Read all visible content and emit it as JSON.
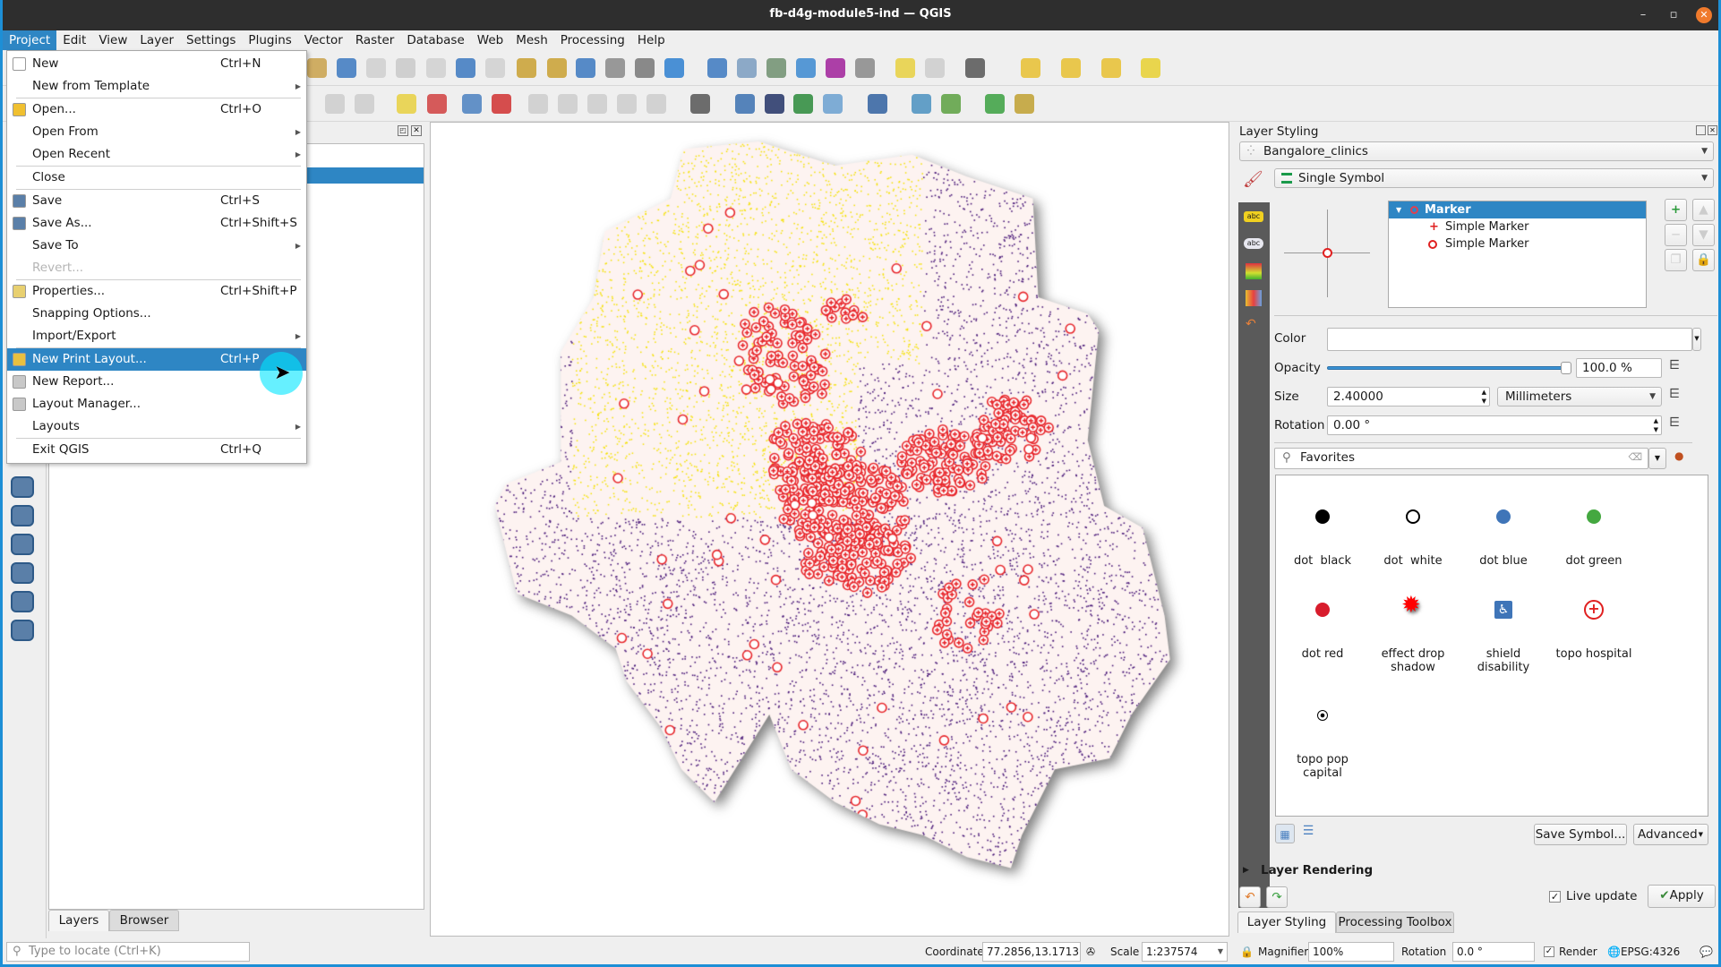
{
  "window": {
    "title": "fb-d4g-module5-ind — QGIS",
    "min": "–",
    "max": "▫",
    "close": "✕"
  },
  "menubar": [
    "Project",
    "Edit",
    "View",
    "Layer",
    "Settings",
    "Plugins",
    "Vector",
    "Raster",
    "Database",
    "Web",
    "Mesh",
    "Processing",
    "Help"
  ],
  "project_menu": [
    {
      "label": "New",
      "shortcut": "Ctrl+N",
      "icon": "new-file-icon",
      "color": "#ffffff"
    },
    {
      "label": "New from Template",
      "submenu": true
    },
    {
      "sep": true
    },
    {
      "label": "Open...",
      "shortcut": "Ctrl+O",
      "icon": "folder-icon",
      "color": "#f0c030"
    },
    {
      "label": "Open From",
      "submenu": true
    },
    {
      "label": "Open Recent",
      "submenu": true
    },
    {
      "sep": true
    },
    {
      "label": "Close"
    },
    {
      "sep": true
    },
    {
      "label": "Save",
      "shortcut": "Ctrl+S",
      "icon": "save-icon",
      "color": "#5a7fa8"
    },
    {
      "label": "Save As...",
      "shortcut": "Ctrl+Shift+S",
      "icon": "save-as-icon",
      "color": "#5a7fa8"
    },
    {
      "label": "Save To",
      "submenu": true
    },
    {
      "label": "Revert...",
      "disabled": true
    },
    {
      "sep": true
    },
    {
      "label": "Properties...",
      "shortcut": "Ctrl+Shift+P",
      "icon": "properties-icon",
      "color": "#e8d070"
    },
    {
      "label": "Snapping Options..."
    },
    {
      "label": "Import/Export",
      "submenu": true
    },
    {
      "sep": true
    },
    {
      "label": "New Print Layout...",
      "shortcut": "Ctrl+P",
      "icon": "print-layout-icon",
      "color": "#e8c040",
      "highlighted": true
    },
    {
      "label": "New Report...",
      "icon": "report-icon",
      "color": "#c8c8c8"
    },
    {
      "label": "Layout Manager...",
      "icon": "layout-manager-icon",
      "color": "#c8c8c8"
    },
    {
      "label": "Layouts",
      "submenu": true
    },
    {
      "sep": true
    },
    {
      "label": "Exit QGIS",
      "shortcut": "Ctrl+Q"
    }
  ],
  "toolbar1_icons": [
    [
      "zoom-in-icon",
      "#c9a14a"
    ],
    [
      "zoom-full-icon",
      "#3b78c0"
    ],
    [
      "zoom-selection-icon",
      "#cfcfcf"
    ],
    [
      "zoom-layer-icon",
      "#c9c9c9"
    ],
    [
      "zoom-native-icon",
      "#d0d0d0"
    ],
    [
      "zoom-last-icon",
      "#3b78c0"
    ],
    [
      "zoom-next-icon",
      "#d0d0d0"
    ],
    [
      "new-bookmark-icon",
      "#c9a030"
    ],
    [
      "show-bookmarks-icon",
      "#c9a030"
    ],
    [
      "spatial-bookmark-icon",
      "#3b78c0"
    ],
    [
      "temporal-icon",
      "#888888"
    ],
    [
      "clock-icon",
      "#777777"
    ],
    [
      "refresh-icon",
      "#2d7fd0"
    ],
    [
      "identify-icon",
      "#3b78c0"
    ],
    [
      "attribute-table-icon",
      "#7a9cc0"
    ],
    [
      "field-calculator-icon",
      "#6f8f6f"
    ],
    [
      "gear-icon",
      "#3b88d0"
    ],
    [
      "sigma-icon",
      "#a0209a"
    ],
    [
      "measure-icon",
      "#888888"
    ],
    [
      "annotation-icon",
      "#e8d040"
    ],
    [
      "map-tips-icon",
      "#cccccc"
    ],
    [
      "text-annotation-icon",
      "#555555"
    ],
    [
      "select-icon",
      "#e8c030"
    ],
    [
      "select-by-value-icon",
      "#e8c030"
    ],
    [
      "deselect-icon",
      "#e8c030"
    ],
    [
      "select-polygon-icon",
      "#e8d030"
    ]
  ],
  "toolbar2_icons": [
    [
      "undo-icon",
      "#cccccc"
    ],
    [
      "redo-icon",
      "#cccccc"
    ],
    [
      "label-icon",
      "#e8d040"
    ],
    [
      "diagram-icon",
      "#d04040"
    ],
    [
      "label-pin-icon",
      "#4a80c0"
    ],
    [
      "label-highlight-icon",
      "#d03030"
    ],
    [
      "label-move-icon",
      "#cccccc"
    ],
    [
      "label-show-icon",
      "#cccccc"
    ],
    [
      "label-rotate-icon",
      "#cccccc"
    ],
    [
      "label-change-icon",
      "#cccccc"
    ],
    [
      "label-edit-icon",
      "#cccccc"
    ],
    [
      "osm-search-icon",
      "#555555"
    ],
    [
      "python-icon",
      "#3a70b0"
    ],
    [
      "globe-icon",
      "#223366"
    ],
    [
      "info-icon",
      "#2a8a3a"
    ],
    [
      "map-swipe-icon",
      "#6aa0d0"
    ],
    [
      "help-icon",
      "#3060a0"
    ],
    [
      "georeferencer-icon",
      "#4a90c0"
    ],
    [
      "raster-calc-icon",
      "#5aa040"
    ],
    [
      "zoom-green-icon",
      "#3aa040"
    ],
    [
      "digitize-icon",
      "#c0a030"
    ]
  ],
  "left_toolbar_icons": [
    "add-vector-layer-icon",
    "add-postgis-layer-icon",
    "add-wms-layer-icon",
    "add-wfs-layer-icon",
    "add-virtual-layer-icon",
    "add-geopackage-icon"
  ],
  "layers_panel": {
    "tabs": [
      "Layers",
      "Browser"
    ],
    "search_placeholder": "Type to locate (Ctrl+K)"
  },
  "layer_styling": {
    "title": "Layer Styling",
    "layer": "Bangalore_clinics",
    "renderer": "Single Symbol",
    "tree": {
      "root": "Marker",
      "children": [
        "Simple Marker",
        "Simple Marker"
      ]
    },
    "color_label": "Color",
    "opacity_label": "Opacity",
    "opacity": 100.0,
    "opacity_text": "100.0 %",
    "size_label": "Size",
    "size": "2.40000",
    "size_unit": "Millimeters",
    "rotation_label": "Rotation",
    "rotation": "0.00 °",
    "library_filter": "Favorites",
    "symbols": [
      {
        "name": "dot  black",
        "icon": "black-dot-icon",
        "color": "#000000"
      },
      {
        "name": "dot  white",
        "icon": "white-dot-icon",
        "color": "#ffffff"
      },
      {
        "name": "dot blue",
        "icon": "blue-dot-icon",
        "color": "#3f75b8"
      },
      {
        "name": "dot green",
        "icon": "green-dot-icon",
        "color": "#44a840"
      },
      {
        "name": "dot red",
        "icon": "red-dot-icon",
        "color": "#d81c2c"
      },
      {
        "name": "effect drop shadow",
        "icon": "star-burst-icon",
        "color": "#ff0000"
      },
      {
        "name": "shield disability",
        "icon": "wheelchair-icon",
        "color": "#3f75b8"
      },
      {
        "name": "topo hospital",
        "icon": "hospital-cross-icon",
        "color": "#e02020"
      },
      {
        "name": "topo pop capital",
        "icon": "capital-dot-icon",
        "color": "#000000"
      }
    ],
    "save_symbol": "Save Symbol...",
    "advanced": "Advanced",
    "layer_rendering": "Layer Rendering",
    "live_update": "Live update",
    "live_update_checked": true,
    "apply": "Apply",
    "tabs": [
      "Layer Styling",
      "Processing Toolbox"
    ]
  },
  "status": {
    "coordinate_label": "Coordinate",
    "coordinate": "77.2856,13.1713",
    "scale_label": "Scale",
    "scale": "1:237574",
    "magnifier_label": "Magnifier",
    "magnifier": "100%",
    "rotation_label": "Rotation",
    "rotation": "0.0 °",
    "render_label": "Render",
    "render_checked": true,
    "crs": "EPSG:4326"
  },
  "map_colors": {
    "background": "#fdf3f1",
    "population": "#4b1a7a",
    "yellow": "#f5e200",
    "clinic": "#e8262b"
  }
}
